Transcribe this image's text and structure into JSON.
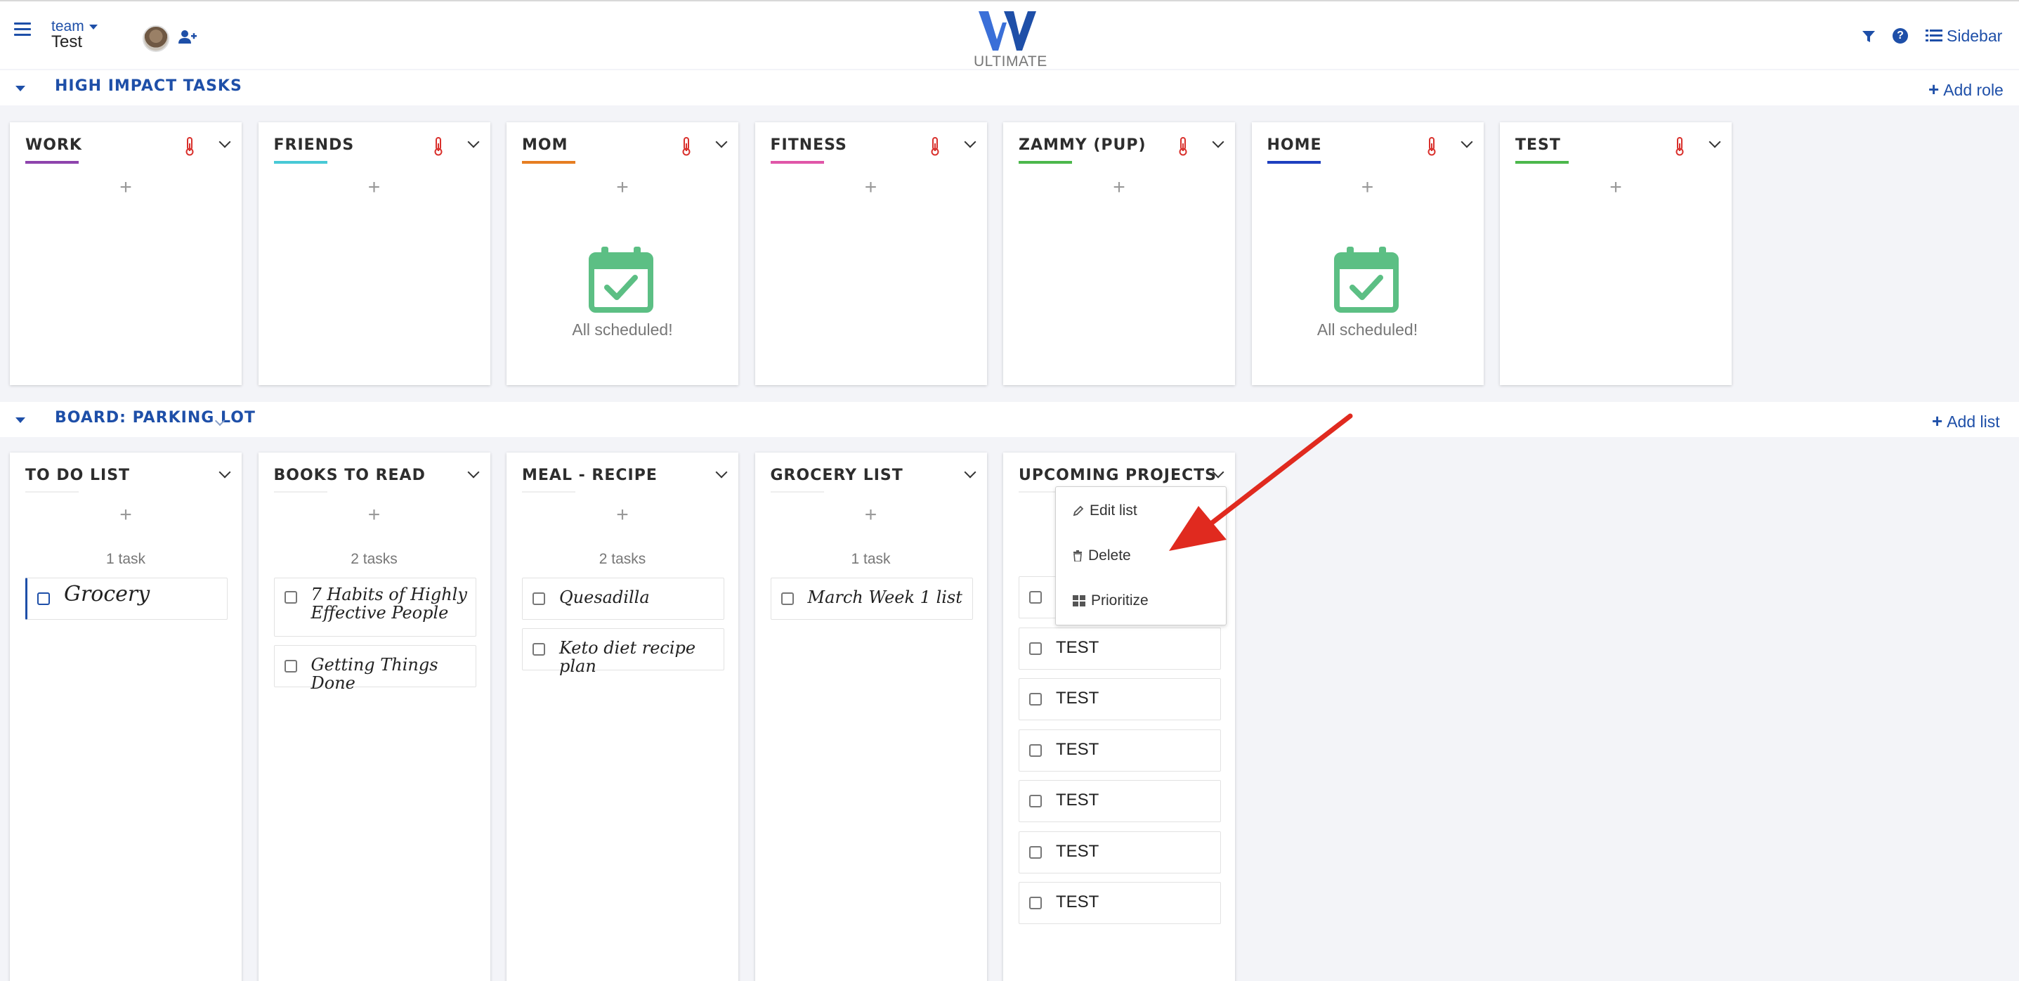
{
  "header": {
    "team_label": "team",
    "team_name": "Test",
    "logo_text": "ULTIMATE",
    "sidebar_label": "Sidebar",
    "brand_color": "#1e4fa8"
  },
  "high_impact": {
    "title": "HIGH IMPACT TASKS",
    "action_label": "Add role",
    "roles": [
      {
        "name": "WORK",
        "color": "#8e44ad",
        "all_scheduled": ""
      },
      {
        "name": "FRIENDS",
        "color": "#48c9d6",
        "all_scheduled": ""
      },
      {
        "name": "MOM",
        "color": "#e67e22",
        "all_scheduled": "All scheduled!"
      },
      {
        "name": "FITNESS",
        "color": "#e056a8",
        "all_scheduled": ""
      },
      {
        "name": "ZAMMY (PUP)",
        "color": "#4cb84c",
        "all_scheduled": ""
      },
      {
        "name": "HOME",
        "color": "#1e3fbf",
        "all_scheduled": "All scheduled!"
      },
      {
        "name": "TEST",
        "color": "#4cb84c",
        "all_scheduled": ""
      }
    ]
  },
  "parking_lot": {
    "title": "BOARD: PARKING LOT",
    "action_label": "Add list",
    "lists": [
      {
        "name": "TO DO LIST",
        "count": "1 task",
        "tasks": [
          "Grocery"
        ]
      },
      {
        "name": "BOOKS TO READ",
        "count": "2 tasks",
        "tasks": [
          "7 Habits of Highly Effective People",
          "Getting Things Done"
        ]
      },
      {
        "name": "MEAL - RECIPE",
        "count": "2 tasks",
        "tasks": [
          "Quesadilla",
          "Keto diet recipe plan"
        ]
      },
      {
        "name": "GROCERY LIST",
        "count": "1 task",
        "tasks": [
          "March Week 1 list"
        ]
      },
      {
        "name": "UPCOMING PROJECTS",
        "count": "",
        "tasks": [
          "TEST",
          "TEST",
          "TEST",
          "TEST",
          "TEST",
          "TEST",
          "TEST"
        ]
      }
    ]
  },
  "list_menu": {
    "edit_label": "Edit list",
    "delete_label": "Delete",
    "prioritize_label": "Prioritize"
  },
  "colors": {
    "calendar_green": "#5cbf84",
    "thermometer_red": "#d9302c",
    "annotation_arrow": "#e02a1f"
  }
}
